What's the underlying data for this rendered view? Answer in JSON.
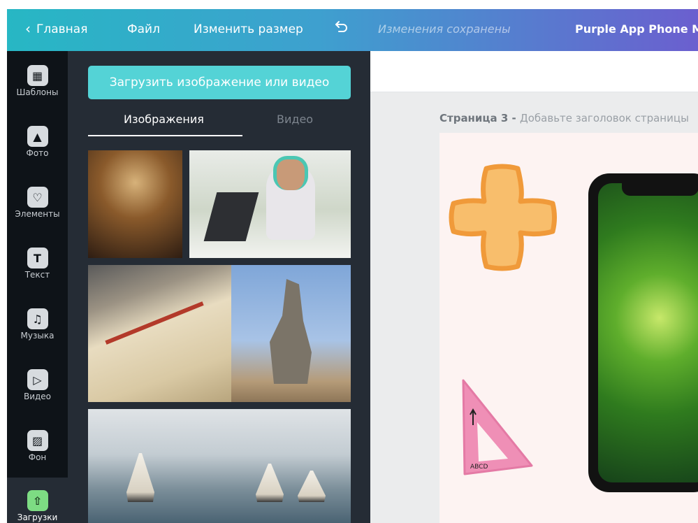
{
  "topbar": {
    "back_label": "Главная",
    "file_label": "Файл",
    "resize_label": "Изменить размер",
    "saved_status": "Изменения сохранены",
    "doc_title": "Purple App Phone Mo"
  },
  "rail": {
    "items": [
      {
        "label": "Шаблоны",
        "icon": "templates-icon"
      },
      {
        "label": "Фото",
        "icon": "photo-icon"
      },
      {
        "label": "Элементы",
        "icon": "elements-icon"
      },
      {
        "label": "Текст",
        "icon": "text-icon"
      },
      {
        "label": "Музыка",
        "icon": "music-icon"
      },
      {
        "label": "Видео",
        "icon": "video-icon"
      },
      {
        "label": "Фон",
        "icon": "background-icon"
      },
      {
        "label": "Загрузки",
        "icon": "upload-cloud-icon"
      }
    ],
    "active": "Загрузки"
  },
  "panel": {
    "upload_button": "Загрузить изображение или видео",
    "tabs": [
      {
        "label": "Изображения",
        "active": true
      },
      {
        "label": "Видео",
        "active": false
      }
    ]
  },
  "canvas": {
    "page_number": "Страница 3 - ",
    "page_title_placeholder": "Добавьте заголовок страницы"
  },
  "colors": {
    "accent_teal": "#54d3d6",
    "active_green": "#7ddc83",
    "panel_bg": "#252c35",
    "rail_bg": "#0e1318"
  }
}
